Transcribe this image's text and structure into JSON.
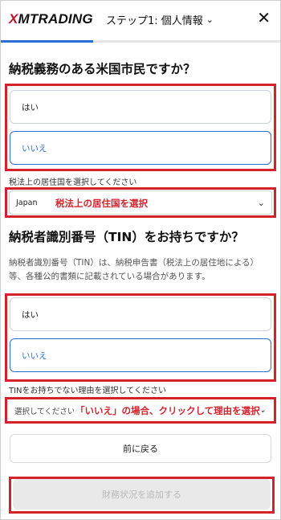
{
  "header": {
    "logo_mark": "X",
    "logo_text": "MTRADING",
    "step_label": "ステップ1: 個人情報",
    "progress_fraction": 0.33
  },
  "q1": {
    "title": "納税義務のある米国市民ですか？",
    "options": [
      "はい",
      "いいえ"
    ],
    "selected": "いいえ"
  },
  "residence": {
    "label": "税法上の居住国を選択してください",
    "value": "Japan",
    "annotation": "税法上の居住国を選択"
  },
  "q2": {
    "title": "納税者識別番号（TIN）をお持ちですか？",
    "description": "納税者識別番号（TIN）は、納税申告書（税法上の居住地による）等、各種公的書類に記載されている場合があります。",
    "options": [
      "はい",
      "いいえ"
    ],
    "selected": "いいえ"
  },
  "reason": {
    "label": "TINをお持ちでない理由を選択してください",
    "placeholder": "選択してください",
    "annotation": "「いいえ」の場合、クリックして理由を選択"
  },
  "buttons": {
    "back": "前に戻る",
    "next": "財務状況を追加する"
  },
  "colors": {
    "accent": "#2b6fd6",
    "annotation_red": "#d6212b",
    "brand_red": "#c8102e"
  }
}
